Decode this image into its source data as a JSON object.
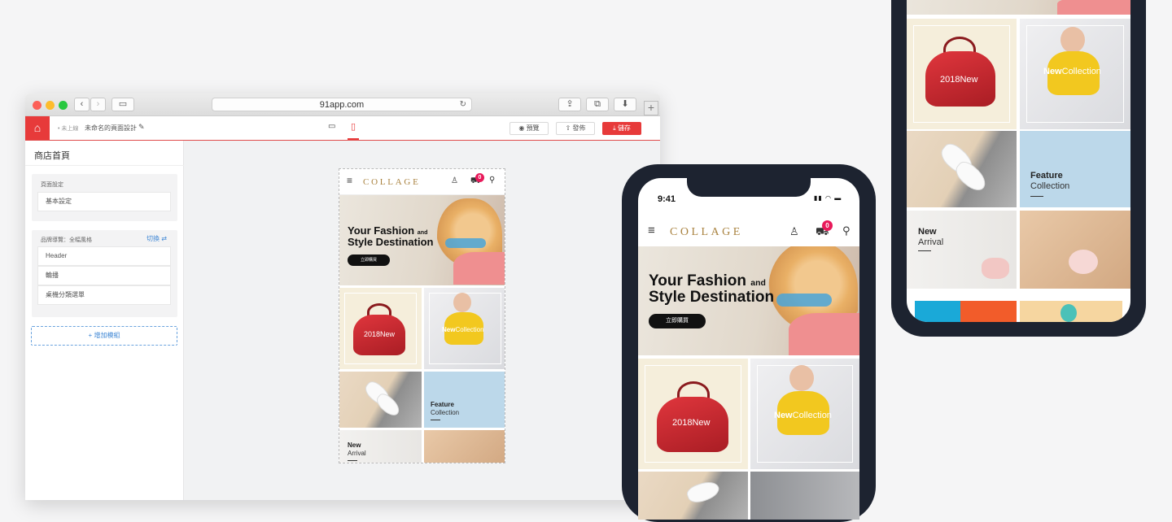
{
  "browser": {
    "url": "91app.com",
    "status": "• 未上線",
    "page_name": "未命名的頁面設計",
    "preview_label": "預覽",
    "publish_label": "發佈",
    "save_label": "儲存"
  },
  "sidebar": {
    "title": "商店首頁",
    "page_settings_label": "頁面設定",
    "basic_settings": "基本設定",
    "brand_nav_label": "品牌導覽：全幅風格",
    "switch_label": "切換",
    "modules": [
      "Header",
      "輪播",
      "桌機分類選單"
    ],
    "add_module": "+ 增加模組"
  },
  "store": {
    "logo": "COLLAGE",
    "cart_count": "0",
    "hero_line1": "Your Fashion",
    "hero_and": "and",
    "hero_line2": "Style Destination",
    "shop_now": "立即購買",
    "tile_bag": "2018New",
    "tile_collection_a": "New",
    "tile_collection_b": "Collection",
    "feature_a": "Feature",
    "feature_b": "Collection",
    "arrival_a": "New",
    "arrival_b": "Arrival"
  },
  "phone": {
    "time": "9:41"
  },
  "colors": {
    "accent": "#e73a3a",
    "logo": "#a9823f",
    "badge": "#e8195a"
  }
}
